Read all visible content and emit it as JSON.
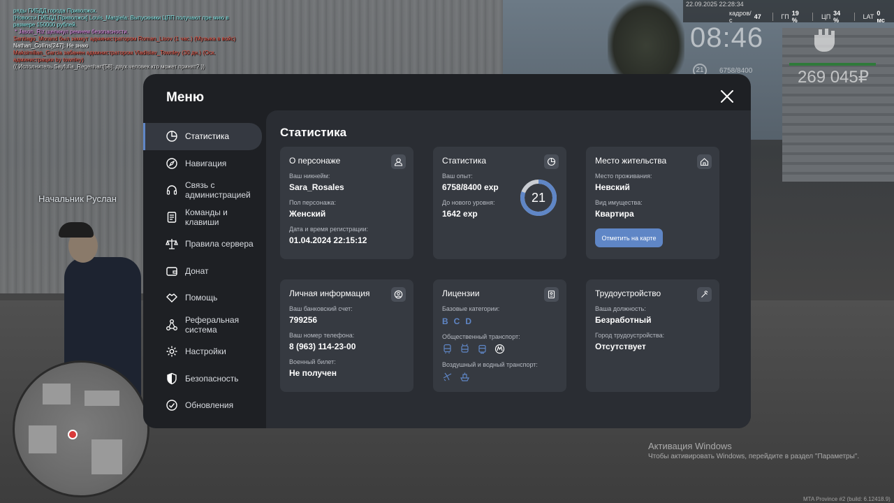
{
  "chat": [
    {
      "text": "ряды ГИБДД города Приволжск.",
      "color": "#7ce0e0"
    },
    {
      "text": "[Новости ГИБДД Приволжск] Louis_Margiela: Выпускники ЦПП получают пре мию в размере 150000 рублей.",
      "color": "#7ce0e0"
    },
    {
      "text": " * Jason_Riz щелкнул ремнем безопасности.",
      "color": "#d87fe0"
    },
    {
      "text": "Santiago_Morand был замкут администратором Roman_Lisov (1 час.) (Музыка в войс)",
      "color": "#e04a3a"
    },
    {
      "text": "Nathan_Collins[247]: Не знаю",
      "color": "#ffffff"
    },
    {
      "text": "Maksimilian_Garcia забанен администратором Vladislav_Townley (30 дн.) (Оск. администрации by townley)",
      "color": "#e04a3a"
    },
    {
      "text": "(( Исполнитель Sayfulla_Regenhart[58]: двух человек кто может принят? ))",
      "color": "#d8d8d8"
    }
  ],
  "hud": {
    "date": "22.09.2025 22:28:34",
    "fps_label": "кадров/с",
    "fps_value": "47",
    "gpu_label": "ГП",
    "gpu_value": "19 %",
    "cpu_label": "ЦП",
    "cpu_value": "34 %",
    "lat_label": "LAT",
    "lat_value": "0 мс",
    "time": "08:46",
    "level": "21",
    "xp": "6758/8400",
    "money": "269 045₽"
  },
  "npc_label": "Начальник Руслан",
  "windows": {
    "title": "Активация Windows",
    "subtitle": "Чтобы активировать Windows, перейдите в раздел \"Параметры\"."
  },
  "build": "MTA Province #2 (build: 6.12418.9)",
  "menu": {
    "title": "Меню",
    "sidebar": [
      {
        "label": "Статистика",
        "icon": "chart-pie-icon",
        "active": true
      },
      {
        "label": "Навигация",
        "icon": "compass-icon"
      },
      {
        "label": "Связь с администрацией",
        "icon": "headset-icon"
      },
      {
        "label": "Команды и клавиши",
        "icon": "document-icon"
      },
      {
        "label": "Правила сервера",
        "icon": "scales-icon"
      },
      {
        "label": "Донат",
        "icon": "wallet-icon"
      },
      {
        "label": "Помощь",
        "icon": "handshake-icon"
      },
      {
        "label": "Реферальная система",
        "icon": "network-icon"
      },
      {
        "label": "Настройки",
        "icon": "gear-icon"
      },
      {
        "label": "Безопасность",
        "icon": "shield-icon"
      },
      {
        "label": "Обновления",
        "icon": "refresh-icon"
      }
    ],
    "content_title": "Статистика",
    "character": {
      "title": "О персонаже",
      "nickname_label": "Ваш никнейм:",
      "nickname": "Sara_Rosales",
      "gender_label": "Пол персонажа:",
      "gender": "Женский",
      "reg_label": "Дата и время регистрации:",
      "reg": "01.04.2024 22:15:12"
    },
    "stats": {
      "title": "Статистика",
      "xp_label": "Ваш опыт:",
      "xp": "6758/8400 exp",
      "next_label": "До нового уровня:",
      "next": "1642 exp",
      "level": "21",
      "progress": 0.8045
    },
    "residence": {
      "title": "Место жительства",
      "place_label": "Место проживания:",
      "place": "Невский",
      "property_label": "Вид имущества:",
      "property": "Квартира",
      "button": "Отметить на карте"
    },
    "personal": {
      "title": "Личная информация",
      "bank_label": "Ваш банковский счет:",
      "bank": "799256",
      "phone_label": "Ваш номер телефона:",
      "phone": "8 (963) 114-23-00",
      "military_label": "Военный билет:",
      "military": "Не получен"
    },
    "licenses": {
      "title": "Лицензии",
      "base_label": "Базовые категории:",
      "categories": [
        "B",
        "C",
        "D"
      ],
      "public_label": "Общественный транспорт:",
      "public_icons": [
        "bus-icon",
        "trolleybus-icon",
        "tram-icon",
        "metro-icon"
      ],
      "air_label": "Воздушный и водный транспорт:",
      "air_icons": [
        "plane-icon",
        "ship-icon"
      ]
    },
    "job": {
      "title": "Трудоустройство",
      "position_label": "Ваша должность:",
      "position": "Безработный",
      "city_label": "Город трудоустройства:",
      "city": "Отсутствует"
    },
    "accent": "#5f86c6"
  }
}
